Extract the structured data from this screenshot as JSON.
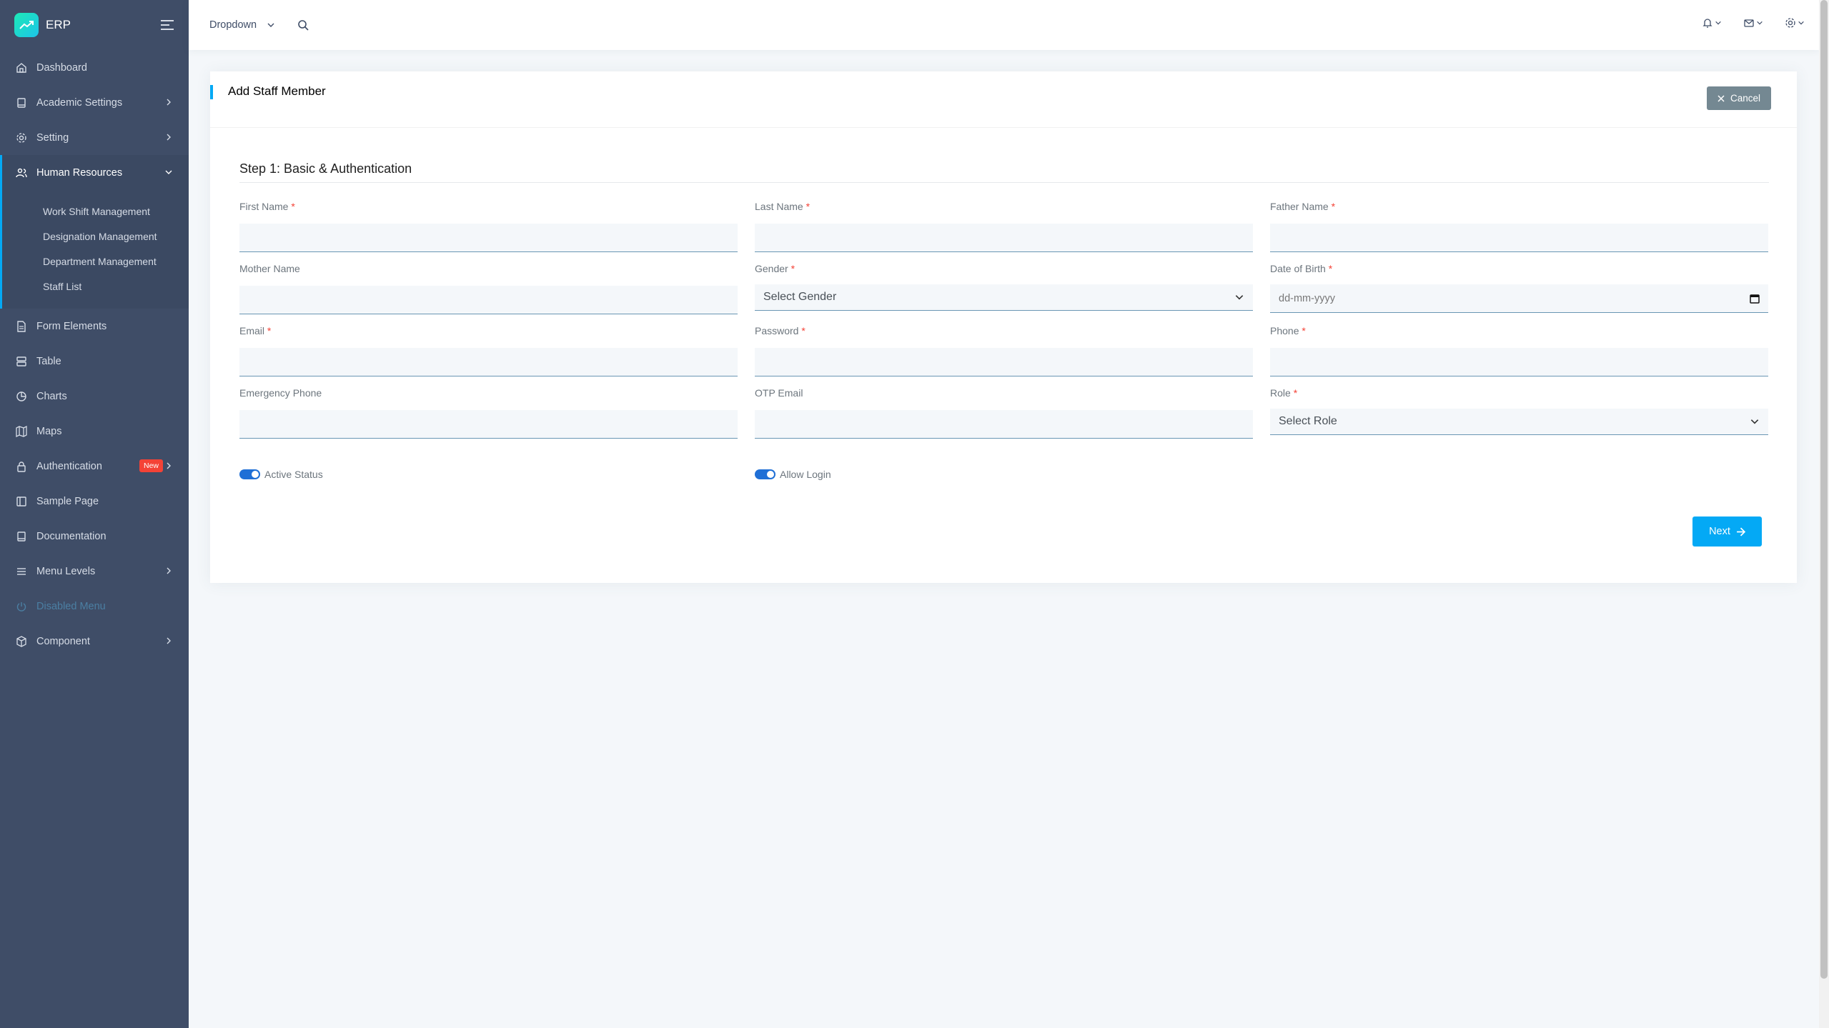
{
  "brand": {
    "name": "ERP"
  },
  "sidebar": {
    "items": [
      {
        "label": "Dashboard",
        "icon": "home-icon"
      },
      {
        "label": "Academic Settings",
        "icon": "book-icon"
      },
      {
        "label": "Setting",
        "icon": "gear-icon"
      },
      {
        "label": "Human Resources",
        "icon": "users-icon"
      },
      {
        "label": "Form Elements",
        "icon": "file-icon"
      },
      {
        "label": "Table",
        "icon": "server-icon"
      },
      {
        "label": "Charts",
        "icon": "pie-chart-icon"
      },
      {
        "label": "Maps",
        "icon": "map-icon"
      },
      {
        "label": "Authentication",
        "icon": "lock-icon",
        "badge": "New"
      },
      {
        "label": "Sample Page",
        "icon": "sidebar-icon"
      },
      {
        "label": "Documentation",
        "icon": "book-icon"
      },
      {
        "label": "Menu Levels",
        "icon": "menu-icon"
      },
      {
        "label": "Disabled Menu",
        "icon": "power-icon"
      },
      {
        "label": "Component",
        "icon": "box-icon"
      }
    ],
    "hr_sub": [
      "Work Shift Management",
      "Designation Management",
      "Department Management",
      "Staff List"
    ]
  },
  "header": {
    "dropdown_label": "Dropdown"
  },
  "card": {
    "title": "Add Staff Member",
    "cancel_label": "Cancel",
    "step_title": "Step 1: Basic & Authentication",
    "next_label": "Next"
  },
  "form": {
    "first_name": "First Name",
    "last_name": "Last Name",
    "father_name": "Father Name",
    "mother_name": "Mother Name",
    "gender": "Gender",
    "gender_placeholder": "Select Gender",
    "dob": "Date of Birth",
    "dob_placeholder": "dd-mm-yyyy",
    "email": "Email",
    "password": "Password",
    "phone": "Phone",
    "emergency_phone": "Emergency Phone",
    "otp_email": "OTP Email",
    "role": "Role",
    "role_placeholder": "Select Role",
    "required_mark": "*",
    "active_status": "Active Status",
    "allow_login": "Allow Login"
  },
  "colors": {
    "sidebar_bg": "#3f4d67",
    "accent": "#04a9f5",
    "cancel_bg": "#748892",
    "badge_bg": "#f44236",
    "toggle_on": "#1f6fd6"
  }
}
